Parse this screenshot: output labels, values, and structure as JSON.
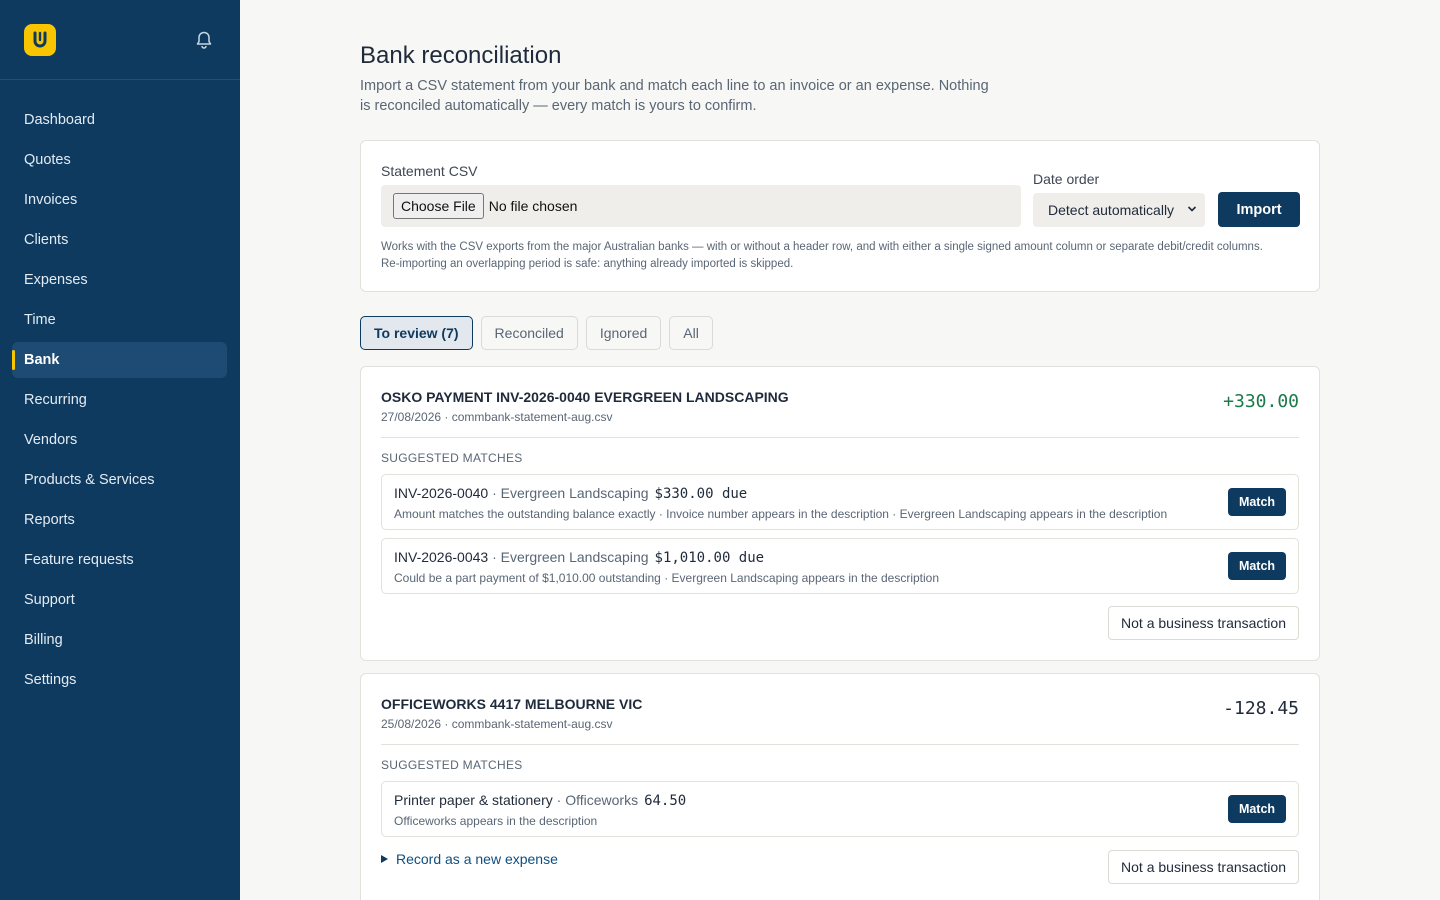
{
  "sidebar": {
    "logo_letter": "U",
    "items": [
      {
        "label": "Dashboard"
      },
      {
        "label": "Quotes"
      },
      {
        "label": "Invoices"
      },
      {
        "label": "Clients"
      },
      {
        "label": "Expenses"
      },
      {
        "label": "Time"
      },
      {
        "label": "Bank",
        "active": true
      },
      {
        "label": "Recurring"
      },
      {
        "label": "Vendors"
      },
      {
        "label": "Products & Services"
      },
      {
        "label": "Reports"
      },
      {
        "label": "Feature requests"
      },
      {
        "label": "Support"
      },
      {
        "label": "Billing"
      },
      {
        "label": "Settings"
      }
    ]
  },
  "page": {
    "title": "Bank reconciliation",
    "subtitle": "Import a CSV statement from your bank and match each line to an invoice or an expense. Nothing is reconciled automatically — every match is yours to confirm."
  },
  "import": {
    "csv_label": "Statement CSV",
    "file_button": "Choose File",
    "file_status": "No file chosen",
    "date_order_label": "Date order",
    "date_order_value": "Detect automatically",
    "import_button": "Import",
    "hint": "Works with the CSV exports from the major Australian banks — with or without a header row, and with either a single signed amount column or separate debit/credit columns. Re-importing an overlapping period is safe: anything already imported is skipped."
  },
  "tabs": [
    {
      "label": "To review (7)",
      "active": true
    },
    {
      "label": "Reconciled"
    },
    {
      "label": "Ignored"
    },
    {
      "label": "All"
    }
  ],
  "transactions": [
    {
      "description": "OSKO PAYMENT INV-2026-0040 EVERGREEN LANDSCAPING",
      "meta": "27/08/2026 · commbank-statement-aug.csv",
      "amount": "+330.00",
      "section_label": "SUGGESTED MATCHES",
      "matches": [
        {
          "ref": "INV-2026-0040",
          "party": " · Evergreen Landscaping",
          "amount": "$330.00 due",
          "reason": "Amount matches the outstanding balance exactly · Invoice number appears in the description · Evergreen Landscaping appears in the description",
          "button": "Match"
        },
        {
          "ref": "INV-2026-0043",
          "party": " · Evergreen Landscaping",
          "amount": "$1,010.00 due",
          "reason": "Could be a part payment of $1,010.00 outstanding · Evergreen Landscaping appears in the description",
          "button": "Match"
        }
      ],
      "ignore_button": "Not a business transaction"
    },
    {
      "description": "OFFICEWORKS 4417 MELBOURNE VIC",
      "meta": "25/08/2026 · commbank-statement-aug.csv",
      "amount": "-128.45",
      "section_label": "SUGGESTED MATCHES",
      "matches": [
        {
          "ref": "Printer paper & stationery",
          "party": " · Officeworks",
          "amount": "64.50",
          "reason": "Officeworks appears in the description",
          "button": "Match"
        }
      ],
      "new_expense_link": "Record as a new expense",
      "ignore_button": "Not a business transaction"
    }
  ],
  "colors": {
    "sidebar_bg": "#0e3a5f",
    "accent": "#f7c600",
    "positive": "#1c7a4a"
  }
}
